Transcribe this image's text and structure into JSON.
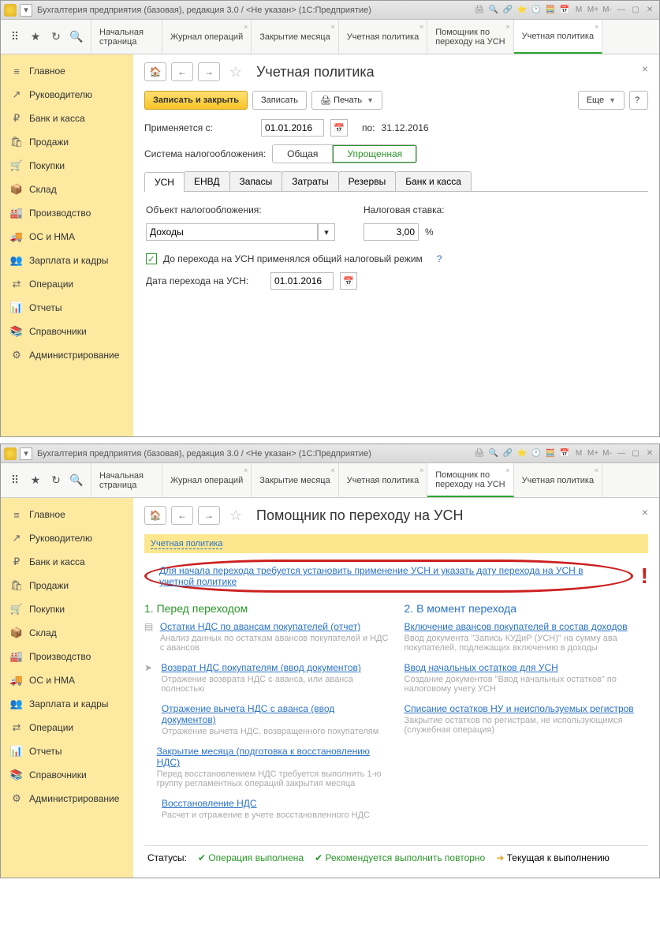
{
  "titlebar": {
    "title": "Бухгалтерия предприятия (базовая), редакция 3.0 / <Не указан>",
    "suffix": "(1С:Предприятие)",
    "mlabels": [
      "M",
      "M+",
      "M-"
    ]
  },
  "toptabs": [
    {
      "label": "Начальная\nстраница"
    },
    {
      "label": "Журнал операций"
    },
    {
      "label": "Закрытие месяца"
    },
    {
      "label": "Учетная политика"
    },
    {
      "label": "Помощник по\nпереходу на УСН"
    },
    {
      "label": "Учетная политика"
    }
  ],
  "sidebar": {
    "items": [
      {
        "icon": "≡",
        "label": "Главное"
      },
      {
        "icon": "↗",
        "label": "Руководителю"
      },
      {
        "icon": "₽",
        "label": "Банк и касса"
      },
      {
        "icon": "🛍",
        "label": "Продажи"
      },
      {
        "icon": "🛒",
        "label": "Покупки"
      },
      {
        "icon": "📦",
        "label": "Склад"
      },
      {
        "icon": "🏭",
        "label": "Производство"
      },
      {
        "icon": "🚚",
        "label": "ОС и НМА"
      },
      {
        "icon": "👥",
        "label": "Зарплата и кадры"
      },
      {
        "icon": "⇄",
        "label": "Операции"
      },
      {
        "icon": "📊",
        "label": "Отчеты"
      },
      {
        "icon": "📚",
        "label": "Справочники"
      },
      {
        "icon": "⚙",
        "label": "Администрирование"
      }
    ]
  },
  "page1": {
    "title": "Учетная политика",
    "btn_save_close": "Записать и закрыть",
    "btn_save": "Записать",
    "btn_print": "Печать",
    "btn_more": "Еще",
    "lbl_applied_from": "Применяется с:",
    "date_from": "01.01.2016",
    "lbl_to": "по:",
    "date_to": "31.12.2016",
    "lbl_tax_system": "Система налогообложения:",
    "seg_general": "Общая",
    "seg_simplified": "Упрощенная",
    "subtabs": [
      "УСН",
      "ЕНВД",
      "Запасы",
      "Затраты",
      "Резервы",
      "Банк и касса"
    ],
    "lbl_tax_object": "Объект налогообложения:",
    "val_tax_object": "Доходы",
    "lbl_tax_rate": "Налоговая ставка:",
    "val_tax_rate": "3,00",
    "pct": "%",
    "chk_label": "До перехода на УСН применялся общий налоговый режим",
    "hint": "?",
    "lbl_transition_date": "Дата перехода на УСН:",
    "val_transition_date": "01.01.2016"
  },
  "page2": {
    "title": "Помощник по переходу на УСН",
    "link_policy": "Учетная политика",
    "warning": "Для начала перехода требуется установить применение УСН и указать дату перехода на УСН в учетной политике",
    "col1_title": "1. Перед переходом",
    "col2_title": "2. В момент перехода",
    "steps1": [
      {
        "link": "Остатки НДС по авансам покупателей (отчет)",
        "desc": "Анализ данных по остаткам авансов покупателей и НДС с авансов"
      },
      {
        "link": "Возврат НДС покупателям (ввод документов)",
        "desc": "Отражение возврата НДС с аванса, или аванса полностью"
      },
      {
        "link": "Отражение вычета НДС с аванса (ввод документов)",
        "desc": "Отражение вычета НДС, возвращенного покупателям"
      },
      {
        "link": "Закрытие месяца (подготовка к восстановлению НДС)",
        "desc": "Перед восстановлением НДС требуется выполнить 1-ю группу регламентных операций закрытия месяца"
      },
      {
        "link": "Восстановление НДС",
        "desc": "Расчет и отражение в учете восстановленного НДС"
      }
    ],
    "steps2": [
      {
        "link": "Включение авансов покупателей в состав доходов",
        "desc": "Ввод документа \"Запись КУДиР (УСН)\" на сумму ава покупателей, подлежащих включению в доходы"
      },
      {
        "link": "Ввод начальных остатков для УСН",
        "desc": "Создание документов \"Ввод начальных остатков\" по налоговому учету УСН"
      },
      {
        "link": "Списание остатков НУ и неиспользуемых регистров",
        "desc": "Закрытие остатков по регистрам, не использующимся (служебная операция)"
      }
    ],
    "status_label": "Статусы:",
    "status_done": "Операция выполнена",
    "status_repeat": "Рекомендуется выполнить повторно",
    "status_current": "Текущая к выполнению"
  }
}
